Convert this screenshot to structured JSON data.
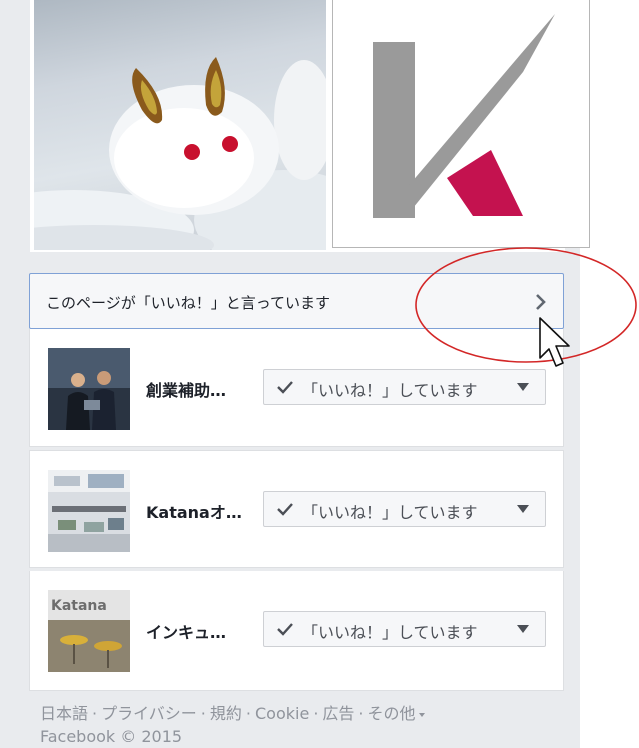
{
  "likes_section": {
    "header_label": "このページが「いいね！」と言っています"
  },
  "liked_pages": [
    {
      "name": "創業補助…",
      "button_label": "「いいね！」しています"
    },
    {
      "name": "Katanaオ…",
      "button_label": "「いいね！」しています"
    },
    {
      "name": "インキュ…",
      "button_label": "「いいね！」しています"
    }
  ],
  "footer": {
    "links": [
      "日本語",
      "プライバシー",
      "規約",
      "Cookie",
      "広告",
      "その他"
    ],
    "copyright": "Facebook © 2015"
  },
  "thumbnails": {
    "katana_sign": "Katana"
  },
  "colors": {
    "highlight_border": "#7fa1d6",
    "annotation_circle": "#d32727",
    "logo_gray": "#9a9a9a",
    "logo_magenta": "#c4124f"
  },
  "icons": {
    "header_chevron": "chevron-right-icon",
    "button_check": "check-icon",
    "button_caret": "caret-down-icon",
    "cursor": "mouse-pointer-icon"
  }
}
